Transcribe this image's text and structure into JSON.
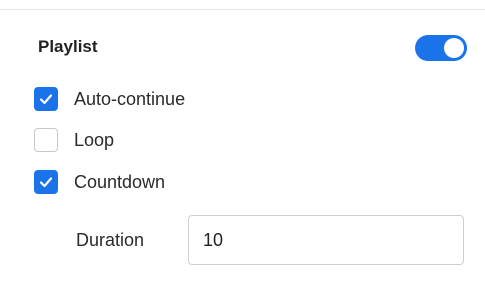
{
  "playlist": {
    "title": "Playlist",
    "enabled": true,
    "accent_color": "#1a73e8",
    "options": [
      {
        "label": "Auto-continue",
        "checked": true
      },
      {
        "label": "Loop",
        "checked": false
      },
      {
        "label": "Countdown",
        "checked": true
      }
    ],
    "duration": {
      "label": "Duration",
      "value": "10"
    }
  }
}
